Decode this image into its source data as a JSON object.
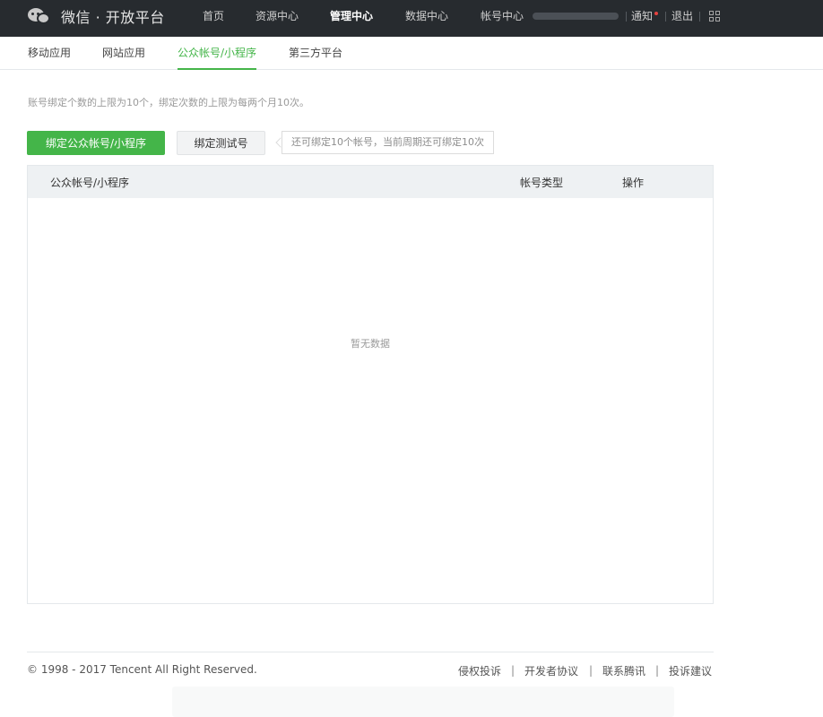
{
  "header": {
    "logo_text": "微信 · 开放平台",
    "nav": [
      {
        "label": "首页"
      },
      {
        "label": "资源中心"
      },
      {
        "label": "管理中心"
      },
      {
        "label": "数据中心"
      },
      {
        "label": "帐号中心"
      }
    ],
    "notice_label": "通知",
    "logout_label": "退出"
  },
  "subnav": {
    "tabs": [
      {
        "label": "移动应用"
      },
      {
        "label": "网站应用"
      },
      {
        "label": "公众帐号/小程序"
      },
      {
        "label": "第三方平台"
      }
    ]
  },
  "main": {
    "hint": "账号绑定个数的上限为10个，绑定次数的上限为每两个月10次。",
    "bind_button": "绑定公众帐号/小程序",
    "test_button": "绑定测试号",
    "tip": "还可绑定10个帐号，当前周期还可绑定10次",
    "table": {
      "columns": [
        "公众帐号/小程序",
        "帐号类型",
        "操作"
      ],
      "rows": [],
      "empty_text": "暂无数据"
    }
  },
  "footer": {
    "copyright": "© 1998 - 2017 Tencent All Right Reserved.",
    "links": [
      "侵权投诉",
      "开发者协议",
      "联系腾讯",
      "投诉建议"
    ],
    "separator": "|"
  },
  "colors": {
    "topbar": "#272b2f",
    "accent": "#44b549",
    "table_header": "#eef1f3"
  }
}
